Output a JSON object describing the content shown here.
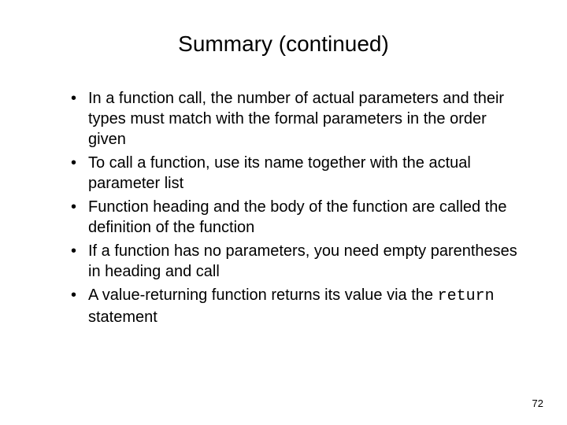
{
  "title": "Summary (continued)",
  "bullets": [
    "In a function call, the number of actual parameters and their types must match with the formal parameters in the order given",
    "To call a function, use its name together with the actual parameter list",
    "Function heading and the body of the function are called the definition of the function",
    "If a function has no parameters, you need  empty parentheses in heading and call"
  ],
  "last_bullet_prefix": "A value-returning function returns its value via the ",
  "last_bullet_code": "return",
  "last_bullet_suffix": " statement",
  "page_number": "72"
}
